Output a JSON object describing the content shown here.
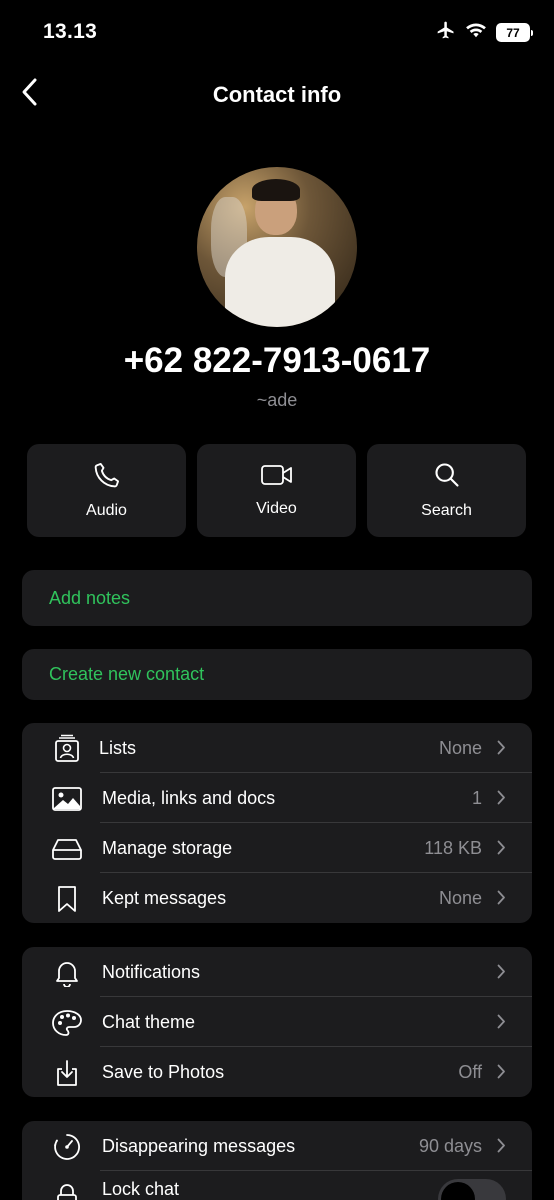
{
  "status": {
    "time": "13.13",
    "battery": "77"
  },
  "nav": {
    "title": "Contact info"
  },
  "contact": {
    "phone": "+62 822-7913-0617",
    "username": "~ade"
  },
  "actions": [
    {
      "label": "Audio",
      "icon": "phone-icon"
    },
    {
      "label": "Video",
      "icon": "video-icon"
    },
    {
      "label": "Search",
      "icon": "search-icon"
    }
  ],
  "notes": {
    "label": "Add notes"
  },
  "create": {
    "label": "Create new contact"
  },
  "group1": [
    {
      "label": "Lists",
      "value": "None",
      "icon": "lists-icon"
    },
    {
      "label": "Media, links and docs",
      "value": "1",
      "icon": "media-icon"
    },
    {
      "label": "Manage storage",
      "value": "118 KB",
      "icon": "storage-icon"
    },
    {
      "label": "Kept messages",
      "value": "None",
      "icon": "bookmark-icon"
    }
  ],
  "group2": [
    {
      "label": "Notifications",
      "value": "",
      "icon": "bell-icon"
    },
    {
      "label": "Chat theme",
      "value": "",
      "icon": "palette-icon"
    },
    {
      "label": "Save to Photos",
      "value": "Off",
      "icon": "save-icon"
    }
  ],
  "group3": [
    {
      "label": "Disappearing messages",
      "value": "90 days",
      "icon": "timer-icon"
    },
    {
      "label": "Lock chat",
      "value": "",
      "icon": "lock-icon",
      "toggle": false
    }
  ],
  "colors": {
    "accent": "#30c35c",
    "card": "#1c1c1e",
    "background": "#000000"
  }
}
